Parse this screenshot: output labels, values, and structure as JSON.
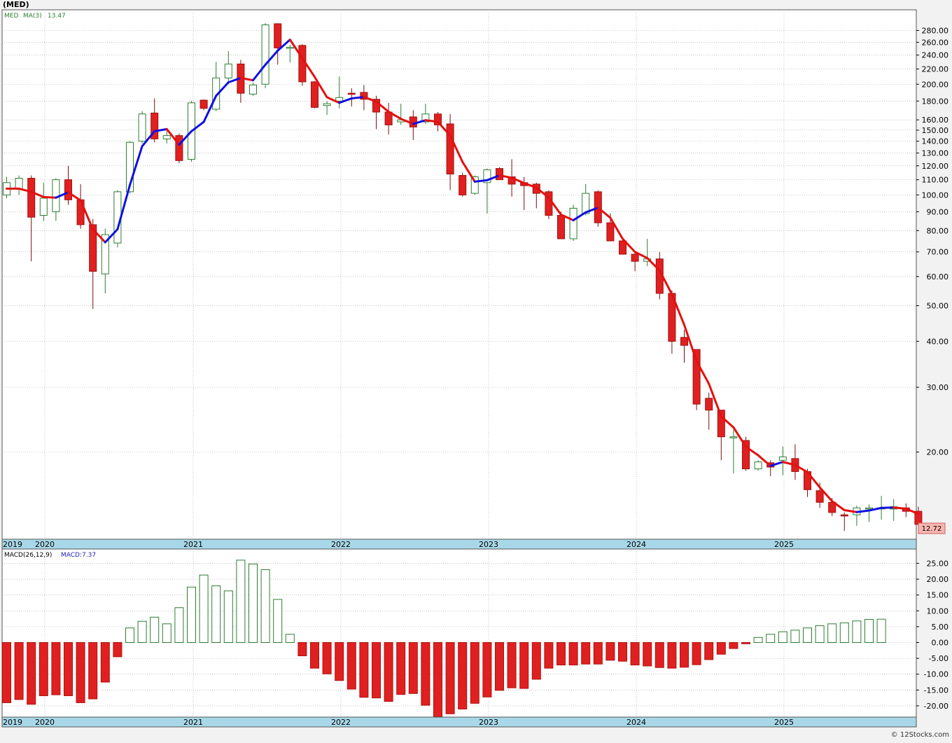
{
  "header": {
    "symbol_label": "(MED)"
  },
  "price_panel": {
    "legend_symbol": "MED",
    "legend_ma": "MA(3)",
    "legend_ma_value": "13.47",
    "last_price_label": "12.72"
  },
  "macd_panel": {
    "legend_name": "MACD(26,12,9)",
    "legend_value": "MACD:7.37"
  },
  "watermark": "© 12Stocks.com",
  "colors": {
    "up_candle": "#2e7d32",
    "down_candle": "#e02020",
    "ma_up": "#1010e0",
    "ma_down": "#e41010",
    "axis_band": "#a8d8e8",
    "grid": "#a0a0a0"
  },
  "chart_data": [
    {
      "type": "candlestick",
      "title": "(MED)",
      "scale": "log",
      "ylim": [
        12,
        300
      ],
      "y_ticks": [
        20,
        30,
        40,
        50,
        60,
        70,
        80,
        90,
        100,
        110,
        120,
        130,
        140,
        150,
        160,
        180,
        200,
        220,
        240,
        260,
        280
      ],
      "y_tick_labels": [
        "20.00",
        "30.00",
        "40.00",
        "50.00",
        "60.00",
        "70.00",
        "80.00",
        "90.00",
        "100.00",
        "110.00",
        "120.00",
        "130.00",
        "140.00",
        "150.00",
        "160.00",
        "180.00",
        "200.00",
        "220.00",
        "240.00",
        "260.00",
        "280.00"
      ],
      "x_labels": [
        "2019",
        "2020",
        "2021",
        "2022",
        "2023",
        "2024",
        "2025"
      ],
      "interval": "monthly",
      "x_start": "2019-12",
      "candles": [
        {
          "o": 100,
          "h": 112,
          "l": 98,
          "c": 108
        },
        {
          "o": 104,
          "h": 113,
          "l": 100,
          "c": 111
        },
        {
          "o": 111,
          "h": 113,
          "l": 66,
          "c": 87
        },
        {
          "o": 88,
          "h": 108,
          "l": 85,
          "c": 98
        },
        {
          "o": 90,
          "h": 111,
          "l": 85,
          "c": 110
        },
        {
          "o": 110,
          "h": 120,
          "l": 94,
          "c": 97
        },
        {
          "o": 97,
          "h": 107,
          "l": 81,
          "c": 83
        },
        {
          "o": 83,
          "h": 86,
          "l": 49,
          "c": 62
        },
        {
          "o": 61,
          "h": 81,
          "l": 54,
          "c": 78
        },
        {
          "o": 74,
          "h": 103,
          "l": 72,
          "c": 102
        },
        {
          "o": 102,
          "h": 140,
          "l": 101,
          "c": 139
        },
        {
          "o": 140,
          "h": 169,
          "l": 138,
          "c": 166
        },
        {
          "o": 167,
          "h": 183,
          "l": 139,
          "c": 142
        },
        {
          "o": 142,
          "h": 150,
          "l": 138,
          "c": 145
        },
        {
          "o": 145,
          "h": 147,
          "l": 122,
          "c": 124
        },
        {
          "o": 125,
          "h": 180,
          "l": 123,
          "c": 178
        },
        {
          "o": 181,
          "h": 182,
          "l": 170,
          "c": 172
        },
        {
          "o": 171,
          "h": 230,
          "l": 169,
          "c": 208
        },
        {
          "o": 208,
          "h": 246,
          "l": 200,
          "c": 227
        },
        {
          "o": 227,
          "h": 233,
          "l": 178,
          "c": 189
        },
        {
          "o": 188,
          "h": 202,
          "l": 186,
          "c": 199
        },
        {
          "o": 200,
          "h": 293,
          "l": 195,
          "c": 290
        },
        {
          "o": 292,
          "h": 293,
          "l": 226,
          "c": 251
        },
        {
          "o": 251,
          "h": 256,
          "l": 229,
          "c": 252
        },
        {
          "o": 255,
          "h": 257,
          "l": 198,
          "c": 203
        },
        {
          "o": 203,
          "h": 204,
          "l": 172,
          "c": 173
        },
        {
          "o": 175,
          "h": 180,
          "l": 165,
          "c": 177
        },
        {
          "o": 180,
          "h": 210,
          "l": 172,
          "c": 184
        },
        {
          "o": 189,
          "h": 195,
          "l": 174,
          "c": 188
        },
        {
          "o": 190,
          "h": 199,
          "l": 170,
          "c": 182
        },
        {
          "o": 182,
          "h": 186,
          "l": 151,
          "c": 168
        },
        {
          "o": 168,
          "h": 178,
          "l": 146,
          "c": 155
        },
        {
          "o": 158,
          "h": 177,
          "l": 155,
          "c": 160
        },
        {
          "o": 163,
          "h": 170,
          "l": 141,
          "c": 153
        },
        {
          "o": 158,
          "h": 177,
          "l": 156,
          "c": 166
        },
        {
          "o": 166,
          "h": 168,
          "l": 149,
          "c": 155
        },
        {
          "o": 156,
          "h": 166,
          "l": 103,
          "c": 114
        },
        {
          "o": 113,
          "h": 115,
          "l": 99,
          "c": 100
        },
        {
          "o": 101,
          "h": 113,
          "l": 100,
          "c": 112
        },
        {
          "o": 108,
          "h": 118,
          "l": 89,
          "c": 117
        },
        {
          "o": 118,
          "h": 119,
          "l": 110,
          "c": 110
        },
        {
          "o": 112,
          "h": 125,
          "l": 99,
          "c": 107
        },
        {
          "o": 108,
          "h": 112,
          "l": 91,
          "c": 106
        },
        {
          "o": 107,
          "h": 108,
          "l": 92,
          "c": 101
        },
        {
          "o": 102,
          "h": 103,
          "l": 86,
          "c": 88
        },
        {
          "o": 88,
          "h": 90,
          "l": 76,
          "c": 76
        },
        {
          "o": 76,
          "h": 94,
          "l": 75,
          "c": 92
        },
        {
          "o": 89,
          "h": 107,
          "l": 88,
          "c": 101
        },
        {
          "o": 102,
          "h": 103,
          "l": 82,
          "c": 84
        },
        {
          "o": 84,
          "h": 89,
          "l": 75,
          "c": 75
        },
        {
          "o": 75,
          "h": 76,
          "l": 69,
          "c": 69
        },
        {
          "o": 69,
          "h": 70,
          "l": 62,
          "c": 66
        },
        {
          "o": 66,
          "h": 76,
          "l": 64,
          "c": 67
        },
        {
          "o": 67,
          "h": 70,
          "l": 52,
          "c": 54
        },
        {
          "o": 54,
          "h": 55,
          "l": 37,
          "c": 40
        },
        {
          "o": 41,
          "h": 43,
          "l": 35,
          "c": 39
        },
        {
          "o": 38,
          "h": 38,
          "l": 26,
          "c": 27
        },
        {
          "o": 28,
          "h": 29,
          "l": 23,
          "c": 26
        },
        {
          "o": 26,
          "h": 26,
          "l": 19,
          "c": 22
        },
        {
          "o": 22,
          "h": 23,
          "l": 17.5,
          "c": 22
        },
        {
          "o": 21.5,
          "h": 22,
          "l": 17.8,
          "c": 18
        },
        {
          "o": 18,
          "h": 19,
          "l": 17.8,
          "c": 18.8
        },
        {
          "o": 18.7,
          "h": 19,
          "l": 17.2,
          "c": 18.2
        },
        {
          "o": 19,
          "h": 20.7,
          "l": 17.3,
          "c": 19.4
        },
        {
          "o": 19.2,
          "h": 21,
          "l": 16.8,
          "c": 17.7
        },
        {
          "o": 17.7,
          "h": 18,
          "l": 15.1,
          "c": 15.8
        },
        {
          "o": 15.7,
          "h": 16.5,
          "l": 14.1,
          "c": 14.6
        },
        {
          "o": 14.6,
          "h": 15,
          "l": 13.4,
          "c": 13.7
        },
        {
          "o": 13.5,
          "h": 13.7,
          "l": 12.2,
          "c": 13.4
        },
        {
          "o": 13.5,
          "h": 14.3,
          "l": 12.6,
          "c": 14.1
        },
        {
          "o": 14.1,
          "h": 14.4,
          "l": 12.9,
          "c": 14.1
        },
        {
          "o": 14.1,
          "h": 15.2,
          "l": 13.1,
          "c": 14.1
        },
        {
          "o": 14,
          "h": 14.9,
          "l": 13,
          "c": 14.2
        },
        {
          "o": 14.1,
          "h": 14.5,
          "l": 13.3,
          "c": 13.8
        },
        {
          "o": 13.8,
          "h": 14.2,
          "l": 12.6,
          "c": 12.72
        }
      ],
      "ma_period": 3,
      "ma_last": 13.47,
      "last_close": 12.72
    },
    {
      "type": "bar",
      "title": "MACD(26,12,9)",
      "ylim": [
        -24,
        28
      ],
      "y_ticks": [
        -20,
        -15,
        -10,
        -5,
        0,
        5,
        10,
        15,
        20,
        25
      ],
      "y_tick_labels": [
        "-20.00",
        "-15.00",
        "-10.00",
        "-5.00",
        "0.00",
        "5.00",
        "10.00",
        "15.00",
        "20.00",
        "25.00"
      ],
      "x_labels": [
        "2019",
        "2020",
        "2021",
        "2022",
        "2023",
        "2024",
        "2025"
      ],
      "values": [
        -19,
        -18,
        -19.5,
        -16.8,
        -16.5,
        -16.8,
        -19,
        -17.8,
        -12.5,
        -4.5,
        4.6,
        6.7,
        8,
        5.9,
        11,
        17.5,
        21.3,
        17.9,
        16.3,
        26,
        24.8,
        23,
        13.6,
        2.6,
        -4.2,
        -8.1,
        -9.9,
        -12,
        -14.7,
        -17.3,
        -17.5,
        -18.6,
        -16.4,
        -16.1,
        -19.8,
        -23.5,
        -22.5,
        -21,
        -19.2,
        -17.2,
        -15.1,
        -14.3,
        -14.5,
        -11.6,
        -8.1,
        -7.1,
        -7.1,
        -6.8,
        -6.8,
        -5.6,
        -5.9,
        -7.1,
        -7.4,
        -7.9,
        -8.1,
        -7.8,
        -7,
        -5.4,
        -3.7,
        -1.9,
        -0.4,
        1.6,
        2.6,
        3.4,
        3.9,
        4.6,
        5.3,
        5.9,
        6.2,
        6.8,
        7.3,
        7.37
      ]
    }
  ]
}
